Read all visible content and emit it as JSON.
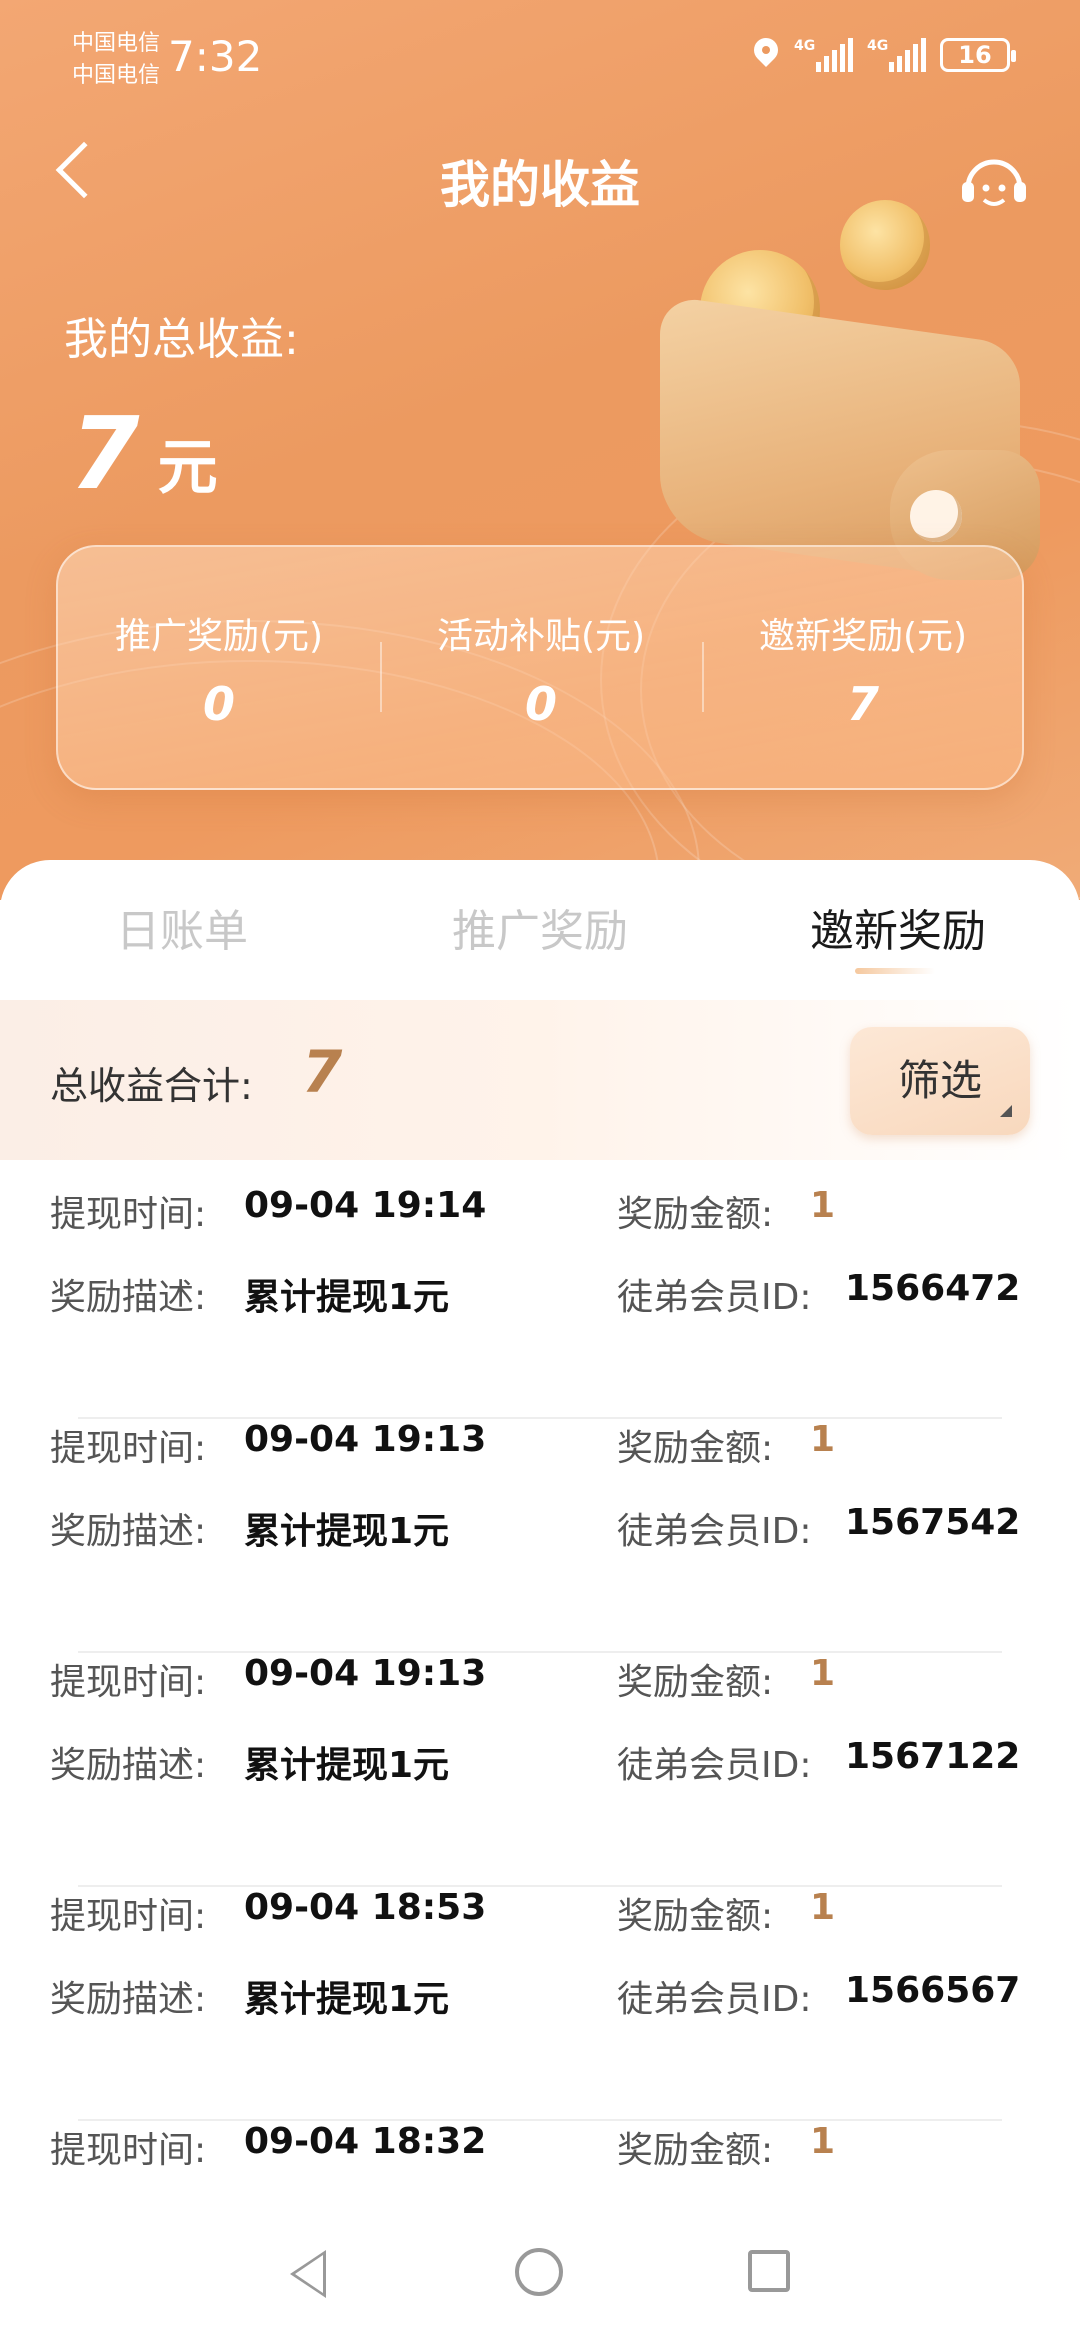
{
  "status_bar": {
    "carrier_1": "中国电信",
    "carrier_2": "中国电信",
    "time": "7:32",
    "network_1": "4G",
    "network_2": "4G",
    "battery": "16"
  },
  "header": {
    "title": "我的收益",
    "back_icon": "chevron-left-icon",
    "service_icon": "customer-service-icon"
  },
  "earnings": {
    "total_label": "我的总收益:",
    "total_value": "7",
    "total_unit": "元",
    "stats": [
      {
        "label": "推广奖励(元)",
        "value": "0"
      },
      {
        "label": "活动补贴(元)",
        "value": "0"
      },
      {
        "label": "邀新奖励(元)",
        "value": "7"
      }
    ]
  },
  "tabs": [
    {
      "label": "日账单",
      "active": false
    },
    {
      "label": "推广奖励",
      "active": false
    },
    {
      "label": "邀新奖励",
      "active": true
    }
  ],
  "summary": {
    "label": "总收益合计:",
    "value": "7",
    "filter_label": "筛选"
  },
  "record_labels": {
    "time": "提现时间:",
    "amount": "奖励金额:",
    "desc": "奖励描述:",
    "member": "徒弟会员ID:"
  },
  "records": [
    {
      "time": "09-04 19:14",
      "amount": "1",
      "desc": "累计提现1元",
      "member_id": "1566472"
    },
    {
      "time": "09-04 19:13",
      "amount": "1",
      "desc": "累计提现1元",
      "member_id": "1567542"
    },
    {
      "time": "09-04 19:13",
      "amount": "1",
      "desc": "累计提现1元",
      "member_id": "1567122"
    },
    {
      "time": "09-04 18:53",
      "amount": "1",
      "desc": "累计提现1元",
      "member_id": "1566567"
    },
    {
      "time": "09-04 18:32",
      "amount": "1",
      "desc": "",
      "member_id": ""
    }
  ],
  "colors": {
    "hero_orange": "#ec9a60",
    "accent_gold": "#b8814f"
  }
}
